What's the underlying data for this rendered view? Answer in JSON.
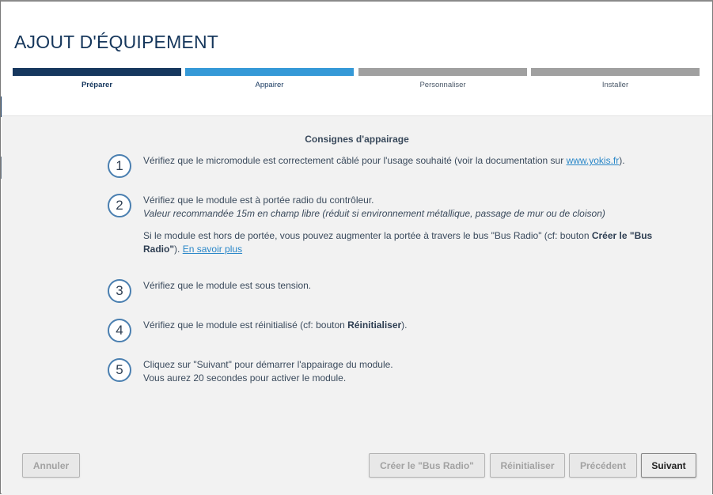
{
  "header": {
    "title": "AJOUT D'ÉQUIPEMENT"
  },
  "steps": [
    {
      "label": "Préparer"
    },
    {
      "label": "Appairer"
    },
    {
      "label": "Personnaliser"
    },
    {
      "label": "Installer"
    }
  ],
  "content": {
    "title": "Consignes d'appairage",
    "items": [
      {
        "number": "1",
        "text_before": "Vérifiez que le micromodule est correctement câblé pour l'usage souhaité (voir la documentation sur ",
        "link": "www.yokis.fr",
        "text_after": ")."
      },
      {
        "number": "2",
        "line1": "Vérifiez que le module est à portée radio du contrôleur.",
        "line2": "Valeur recommandée 15m en champ libre (réduit si environnement métallique, passage de mur ou de cloison)",
        "extra_before": "Si le module est hors de portée, vous pouvez augmenter la portée à travers le bus \"Bus Radio\" (cf: bouton ",
        "extra_bold": "Créer le \"Bus Radio\"",
        "extra_after": "). ",
        "extra_link": "En savoir plus"
      },
      {
        "number": "3",
        "text": "Vérifiez que le module est sous tension."
      },
      {
        "number": "4",
        "text_before": "Vérifiez que le module est réinitialisé (cf: bouton ",
        "bold": "Réinitialiser",
        "text_after": ")."
      },
      {
        "number": "5",
        "line1": "Cliquez sur \"Suivant\" pour démarrer l'appairage du module.",
        "line2": "Vous aurez 20 secondes pour activer le module."
      }
    ]
  },
  "buttons": {
    "cancel": "Annuler",
    "create_bus": "Créer le \"Bus Radio\"",
    "reset": "Réinitialiser",
    "previous": "Précédent",
    "next": "Suivant"
  }
}
